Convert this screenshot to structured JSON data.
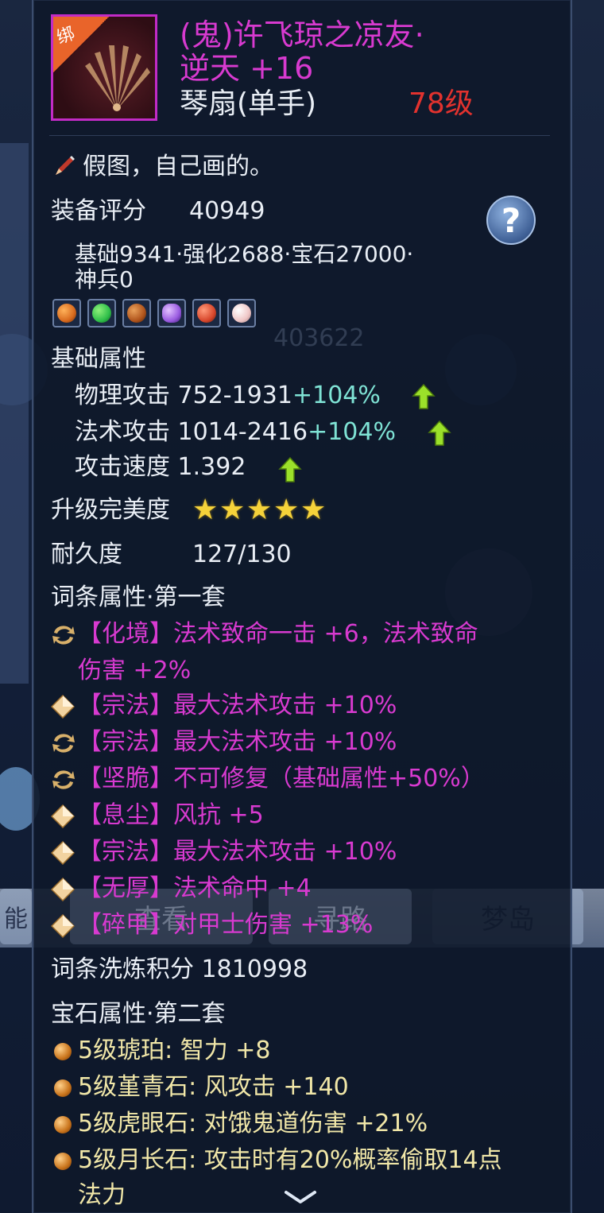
{
  "item": {
    "bind_tag": "绑",
    "name_line1": "(鬼)许飞琼之凉友·",
    "name_line2": "逆天 +16",
    "type": "琴扇(单手)",
    "level": "78级",
    "description": "假图，自己画的。"
  },
  "score": {
    "label": "装备评分",
    "value": "40949",
    "breakdown_line1": "基础9341·强化2688·宝石27000·",
    "breakdown_line2": "神兵0",
    "help_label": "?"
  },
  "background_score": "403622",
  "base_attrs": {
    "title": "基础属性",
    "items": [
      {
        "name": "物理攻击",
        "value": "752-1931",
        "bonus": "+104%"
      },
      {
        "name": "法术攻击",
        "value": "1014-2416",
        "bonus": "+104%"
      },
      {
        "name": "攻击速度",
        "value": "1.392",
        "bonus": ""
      }
    ]
  },
  "upgrade": {
    "label": "升级完美度",
    "stars": 5,
    "star_glyph": "★"
  },
  "durability": {
    "label": "耐久度",
    "value": "127/130"
  },
  "affix": {
    "title": "词条属性·第一套",
    "items": [
      {
        "icon": "swap-icon",
        "tag": "【化境】",
        "text": "法术致命一击 +6，法术致命",
        "text2": "伤害 +2%"
      },
      {
        "icon": "diamond-icon",
        "tag": "【宗法】",
        "text": "最大法术攻击 +10%"
      },
      {
        "icon": "swap-icon",
        "tag": "【宗法】",
        "text": "最大法术攻击 +10%"
      },
      {
        "icon": "swap-icon",
        "tag": "【坚脆】",
        "text": "不可修复（基础属性+50%）"
      },
      {
        "icon": "diamond-icon",
        "tag": "【息尘】",
        "text": "风抗 +5"
      },
      {
        "icon": "diamond-icon",
        "tag": "【宗法】",
        "text": "最大法术攻击 +10%"
      },
      {
        "icon": "diamond-icon",
        "tag": "【无厚】",
        "text": "法术命中 +4"
      },
      {
        "icon": "diamond-icon",
        "tag": "【碎甲】",
        "text": "对甲士伤害 +13%"
      }
    ],
    "wash_label": "词条洗炼积分",
    "wash_value": "1810998"
  },
  "gems": {
    "title": "宝石属性·第二套",
    "items": [
      {
        "text": "5级琥珀: 智力 +8"
      },
      {
        "text": "5级堇青石: 风攻击 +140"
      },
      {
        "text": "5级虎眼石: 对饿鬼道伤害 +21%"
      },
      {
        "text": "5级月长石: 攻击时有20%概率偷取14点",
        "text2": "法力"
      }
    ],
    "slot_colors": [
      "#d86a1e",
      "#2fbf4a",
      "#b0541c",
      "#9a5be0",
      "#d8472c",
      "#efc6c6"
    ]
  },
  "background_buttons": {
    "left": "能",
    "b1": "查看",
    "b2": "寻路",
    "b3": "梦岛"
  },
  "colors": {
    "pink": "#d83ad0",
    "red": "#e2322e",
    "cyan": "#7fe3d5",
    "arrow_green": "#9be02a"
  }
}
